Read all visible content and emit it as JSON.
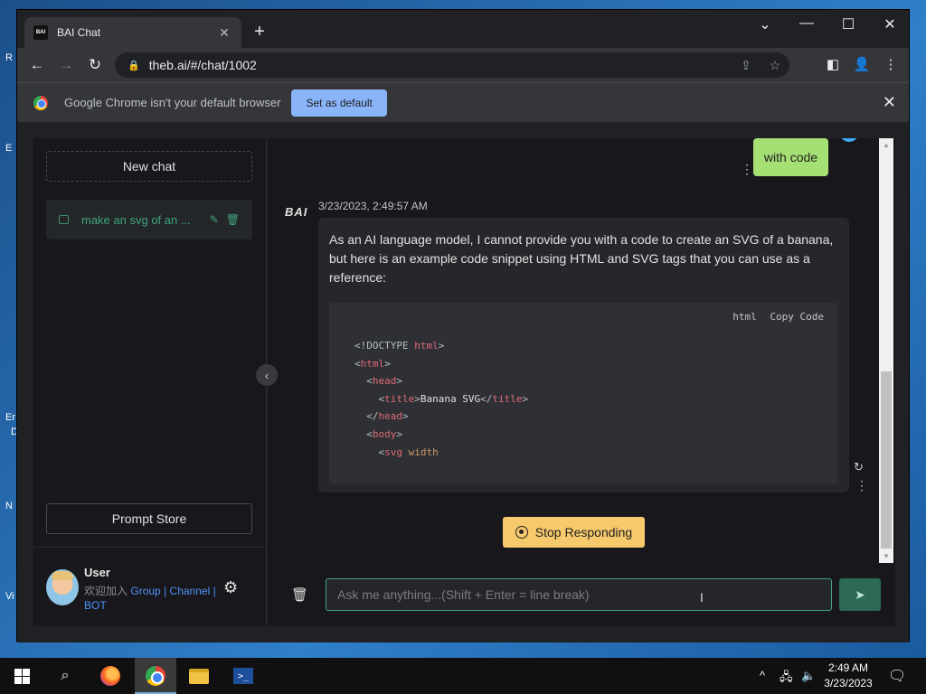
{
  "browser": {
    "tab_title": "BAI Chat",
    "tab_favicon_text": "BAI",
    "url": "theb.ai/#/chat/1002",
    "infobar_text": "Google Chrome isn't your default browser",
    "set_default_label": "Set as default"
  },
  "sidebar": {
    "new_chat_label": "New chat",
    "chat_items": [
      {
        "label": "make an svg of an ..."
      }
    ],
    "prompt_store_label": "Prompt Store",
    "user": {
      "name": "User",
      "desc_prefix": "欢迎加入",
      "link_group": "Group",
      "sep1": "|",
      "link_channel": "Channel",
      "sep2": "|",
      "link_bot": "BOT"
    }
  },
  "chat": {
    "user_message": "with code",
    "bot_logo": "BAI",
    "timestamp": "3/23/2023, 2:49:57 AM",
    "bot_message": "As an AI language model, I cannot provide you with a code to create an SVG of a banana, but here is an example code snippet using HTML and SVG tags that you can use as a reference:",
    "code": {
      "language": "html",
      "copy_label": "Copy Code",
      "line1_open": "<!DOCTYPE",
      "line1_word": "html",
      "line1_close": ">",
      "line2_open": "<",
      "line2_tag": "html",
      "line2_close": ">",
      "line3_open": "<",
      "line3_tag": "head",
      "line3_close": ">",
      "line4_open": "<",
      "line4_tag": "title",
      "line4_close": ">",
      "line4_text": "Banana SVG",
      "line4_end_open": "</",
      "line4_end_tag": "title",
      "line4_end_close": ">",
      "line5_open": "</",
      "line5_tag": "head",
      "line5_close": ">",
      "line6_open": "<",
      "line6_tag": "body",
      "line6_close": ">",
      "line7_open": "<",
      "line7_tag": "svg",
      "line7_attr": "width"
    },
    "stop_label": "Stop Responding",
    "input_placeholder": "Ask me anything...(Shift + Enter = line break)"
  },
  "taskbar": {
    "time": "2:49 AM",
    "date": "3/23/2023",
    "powershell_glyph": ">_"
  },
  "desktop": {
    "icon_labels": [
      "R",
      "E",
      "Er",
      "D",
      "N",
      "Vi"
    ]
  }
}
